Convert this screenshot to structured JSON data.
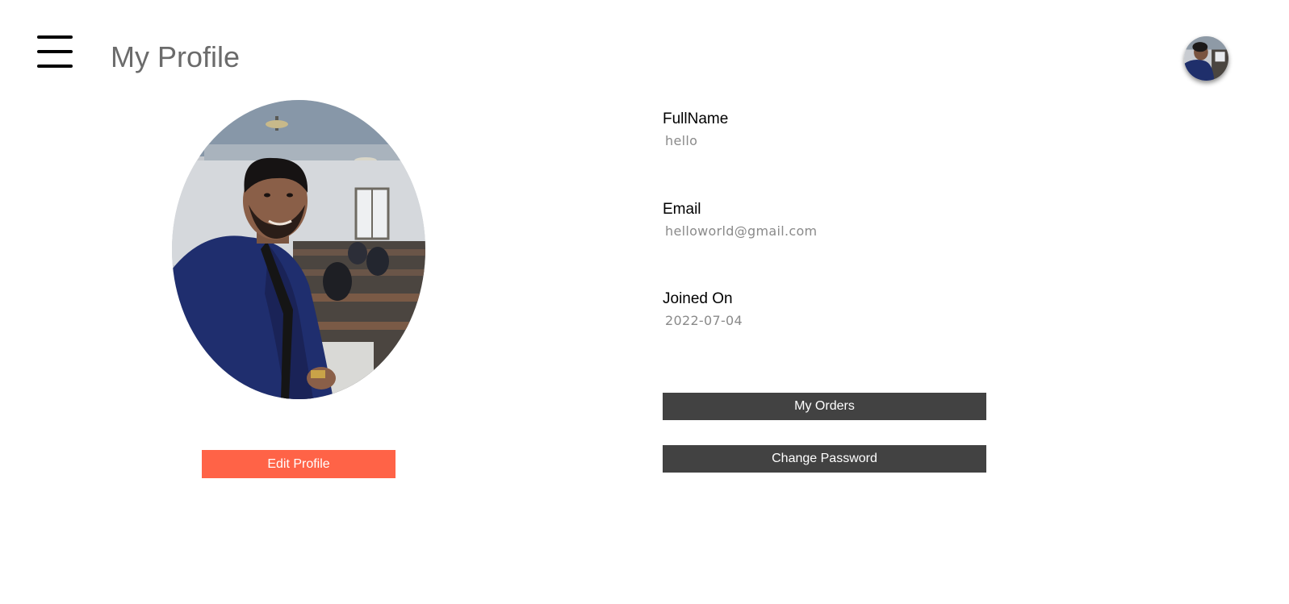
{
  "header": {
    "menu_icon": "hamburger-menu-icon",
    "title": "My Profile",
    "avatar_icon": "user-avatar"
  },
  "profile": {
    "edit_button_label": "Edit Profile",
    "fields": [
      {
        "label": "FullName",
        "value": "hello"
      },
      {
        "label": "Email",
        "value": "helloworld@gmail.com"
      },
      {
        "label": "Joined On",
        "value": "2022-07-04"
      }
    ],
    "actions": {
      "orders_label": "My Orders",
      "change_password_label": "Change Password"
    }
  },
  "colors": {
    "edit_button": "#ff6347",
    "action_button": "#424242",
    "title_text": "#6b6b6b",
    "value_text": "#8a8a8a"
  }
}
